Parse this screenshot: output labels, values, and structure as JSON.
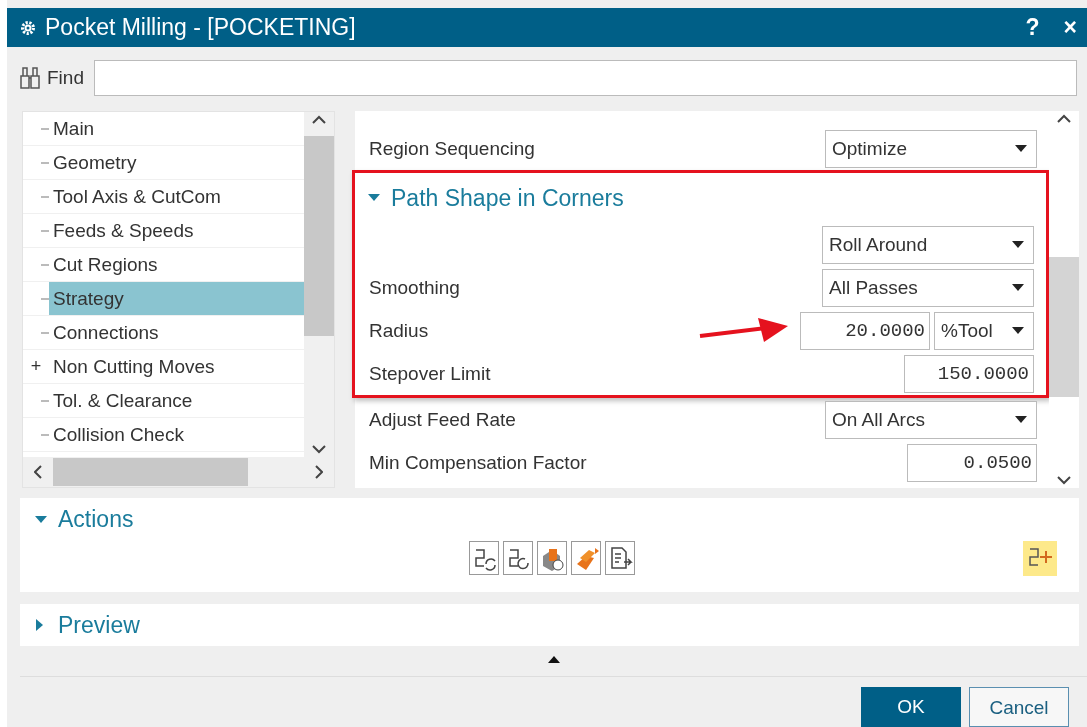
{
  "window": {
    "title": "Pocket Milling - [POCKETING]",
    "help": "?",
    "close": "×"
  },
  "find": {
    "label": "Find"
  },
  "tree": [
    {
      "label": "Main",
      "selected": false,
      "kind": "leaf"
    },
    {
      "label": "Geometry",
      "selected": false,
      "kind": "leaf"
    },
    {
      "label": "Tool Axis & CutCom",
      "selected": false,
      "kind": "leaf"
    },
    {
      "label": "Feeds & Speeds",
      "selected": false,
      "kind": "leaf"
    },
    {
      "label": "Cut Regions",
      "selected": false,
      "kind": "leaf"
    },
    {
      "label": "Strategy",
      "selected": true,
      "kind": "leaf"
    },
    {
      "label": "Connections",
      "selected": false,
      "kind": "leaf"
    },
    {
      "label": "Non Cutting Moves",
      "selected": false,
      "kind": "expandable",
      "expander": "+"
    },
    {
      "label": "Tol. & Clearance",
      "selected": false,
      "kind": "leaf"
    },
    {
      "label": "Collision Check",
      "selected": false,
      "kind": "leaf"
    }
  ],
  "params": [
    {
      "kind": "dropdown",
      "label": "Region Sequencing",
      "value": "Optimize"
    },
    {
      "kind": "group",
      "title": "Path Shape in Corners",
      "expanded": true,
      "highlighted": true,
      "rows": [
        {
          "kind": "dropdown",
          "value": "Roll Around"
        },
        {
          "kind": "dropdown",
          "label": "Smoothing",
          "value": "All Passes"
        },
        {
          "kind": "number_unit",
          "label": "Radius",
          "value": "20.0000",
          "unit": "%Tool",
          "pointed": true
        },
        {
          "kind": "number",
          "label": "Stepover Limit",
          "value": "150.0000"
        }
      ]
    },
    {
      "kind": "dropdown",
      "label": "Adjust Feed Rate",
      "value": "On All Arcs"
    },
    {
      "kind": "number",
      "label": "Min Compensation Factor",
      "value": "0.0500"
    }
  ],
  "sections": [
    {
      "title": "Actions",
      "expanded": true
    },
    {
      "title": "Preview",
      "expanded": false
    }
  ],
  "buttons": [
    {
      "label": "OK",
      "kind": "primary"
    },
    {
      "label": "Cancel",
      "kind": "secondary"
    }
  ]
}
